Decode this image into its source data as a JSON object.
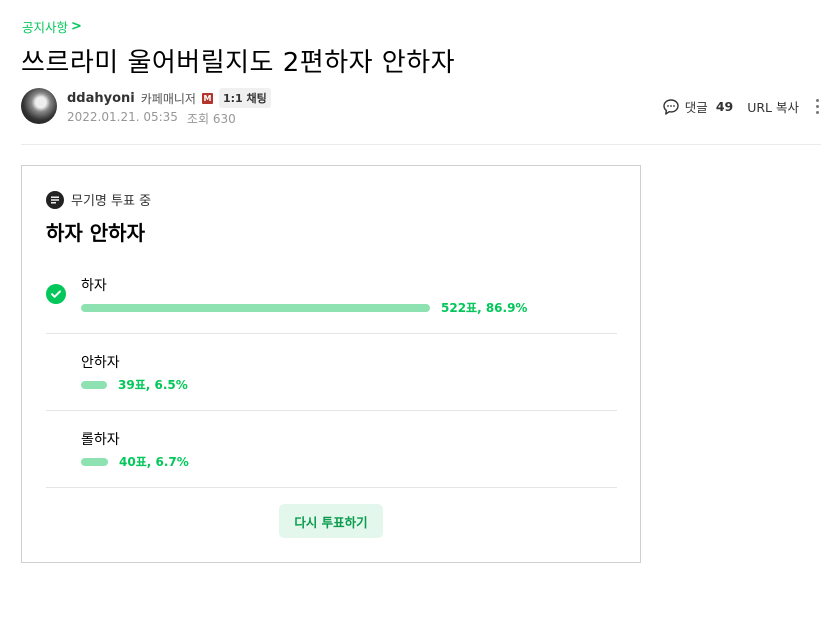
{
  "board": {
    "name": "공지사항",
    "chevron": ">"
  },
  "article": {
    "title": "쓰르라미 울어버릴지도 2편하자 안하자",
    "author": {
      "nickname": "ddahyoni",
      "role": "카페매니저",
      "manager_badge": "M",
      "chat_badge": "1:1 채팅"
    },
    "date": "2022.01.21. 05:35",
    "views_label": "조회 630"
  },
  "actions": {
    "comment_label": "댓글",
    "comment_count": "49",
    "url_copy_label": "URL 복사"
  },
  "poll": {
    "status": "무기명 투표 중",
    "title": "하자 안하자",
    "options": [
      {
        "label": "하자",
        "result": "522표, 86.9%",
        "percent": 86.9,
        "selected": true
      },
      {
        "label": "안하자",
        "result": "39표, 6.5%",
        "percent": 6.5,
        "selected": false
      },
      {
        "label": "롤하자",
        "result": "40표, 6.7%",
        "percent": 6.7,
        "selected": false
      }
    ],
    "revote_label": "다시 투표하기"
  },
  "colors": {
    "accent": "#03c75a",
    "bar": "#8ee2b2",
    "revote_bg": "#e3f7ec"
  }
}
